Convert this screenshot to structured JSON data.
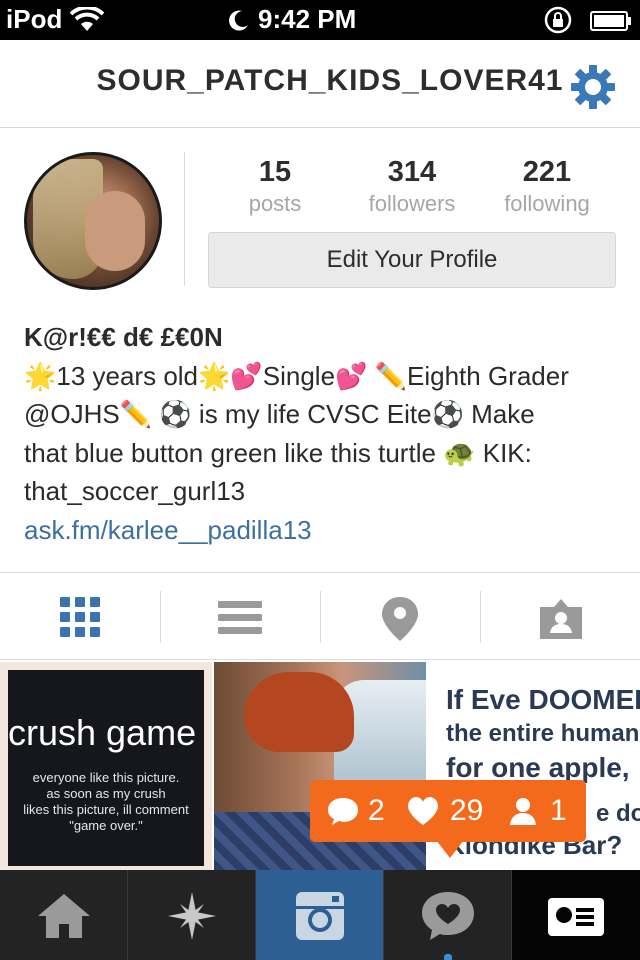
{
  "status_bar": {
    "carrier": "iPod",
    "time": "9:42 PM"
  },
  "nav": {
    "username": "SOUR_PATCH_KIDS_LOVER41",
    "settings_icon": "gear-icon"
  },
  "profile": {
    "stats": [
      {
        "value": "15",
        "label": "posts"
      },
      {
        "value": "314",
        "label": "followers"
      },
      {
        "value": "221",
        "label": "following"
      }
    ],
    "edit_button": "Edit Your Profile",
    "display_name": "K@r!€€ d€ £€0N",
    "bio_lines": [
      "🌟13 years old🌟💕Single💕 ✏️Eighth Grader",
      "@OJHS✏️ ⚽ is my life CVSC Eite⚽ Make",
      "that blue button green like this turtle 🐢 KIK:",
      "that_soccer_gurl13"
    ],
    "link": "ask.fm/karlee__padilla13"
  },
  "tabs": [
    "grid-view-icon",
    "list-view-icon",
    "location-pin-icon",
    "tagged-photos-icon"
  ],
  "photos": {
    "p1": {
      "title": "crush game",
      "text_lines": [
        "everyone like this picture.",
        "as soon as my crush",
        "likes this picture, ill comment",
        "\"game over.\""
      ]
    },
    "p3": {
      "lines": [
        "If Eve DOOMED",
        "the entire human race",
        "for one apple,",
        "e do",
        "Klondike Bar?"
      ]
    }
  },
  "notification": {
    "comments": "2",
    "likes": "29",
    "followers": "1"
  },
  "tab_bar": [
    "home-icon",
    "explore-icon",
    "camera-icon",
    "news-icon",
    "profile-icon"
  ],
  "colors": {
    "accent": "#2e5f92",
    "notification": "#f36a1d",
    "link": "#3c70a0"
  }
}
